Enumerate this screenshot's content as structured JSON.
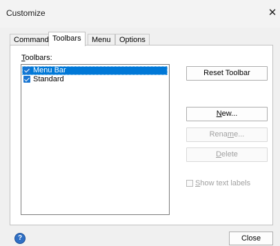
{
  "window": {
    "title": "Customize",
    "close_glyph": "✕"
  },
  "tabs": [
    {
      "label": "Commands",
      "active": false
    },
    {
      "label": "Toolbars",
      "active": true
    },
    {
      "label": "Menu",
      "active": false
    },
    {
      "label": "Options",
      "active": false
    }
  ],
  "toolbars_label": {
    "mnemonic": "T",
    "rest": "oolbars:"
  },
  "toolbar_list": [
    {
      "label": "Menu Bar",
      "checked": true,
      "selected": true
    },
    {
      "label": "Standard",
      "checked": true,
      "selected": false
    }
  ],
  "buttons": {
    "reset": {
      "label": "Reset Toolbar"
    },
    "new": {
      "mnemonic": "N",
      "rest": "ew..."
    },
    "rename": {
      "pre": "Rena",
      "mnemonic": "m",
      "rest": "e...",
      "disabled": true
    },
    "delete": {
      "mnemonic": "D",
      "rest": "elete",
      "disabled": true
    }
  },
  "show_text_labels": {
    "mnemonic": "S",
    "rest": "how text labels",
    "checked": false,
    "disabled": true
  },
  "footer": {
    "help_glyph": "?",
    "close_label": "Close"
  },
  "colors": {
    "selection": "#0078d7",
    "checkbox": "#1a76d2",
    "disabled_text": "#a0a0a0"
  }
}
